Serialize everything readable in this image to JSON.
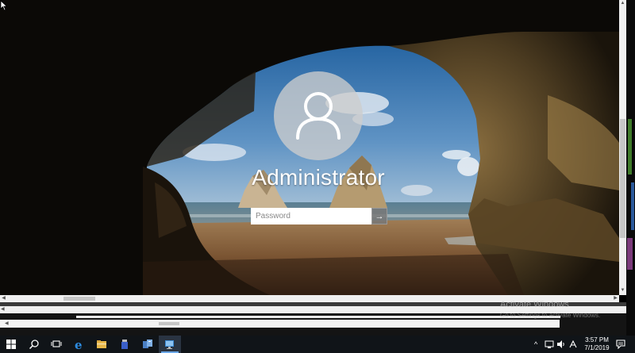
{
  "login": {
    "username": "Administrator",
    "password_placeholder": "Password",
    "submit_glyph": "→"
  },
  "watermark": {
    "title": "Activate Windows",
    "subtitle": "Go to Settings to activate Windows."
  },
  "taskbar": {
    "icons": [
      "windows-start-icon",
      "search-icon",
      "task-view-icon",
      "internet-explorer-icon",
      "file-explorer-icon",
      "usb-app-icon",
      "server-manager-icon",
      "remote-desktop-icon"
    ],
    "tray_chevron": "^",
    "time": "3:57 PM",
    "date": "7/1/2019"
  },
  "colors": {
    "taskbar": "#101418",
    "sky": "#2f6fb0",
    "sand": "#8f6a3f",
    "accent": "#6aa7e8"
  }
}
